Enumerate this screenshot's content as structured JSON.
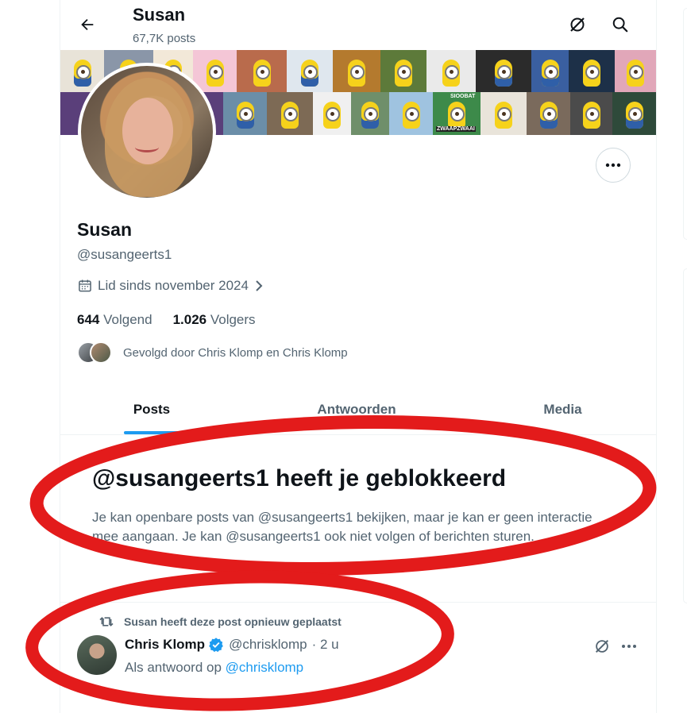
{
  "header": {
    "name": "Susan",
    "post_count": "67,7K posts"
  },
  "profile": {
    "name": "Susan",
    "handle": "@susangeerts1",
    "joined": "Lid sinds november 2024",
    "following_count": "644",
    "following_label": "Volgend",
    "followers_count": "1.026",
    "followers_label": "Volgers",
    "followed_by": "Gevolgd door Chris Klomp en Chris Klomp"
  },
  "banner": {
    "tile_texts": [
      "SIOOBAT",
      "ZWAAPZWAAI"
    ]
  },
  "tabs": [
    {
      "label": "Posts",
      "active": true
    },
    {
      "label": "Antwoorden",
      "active": false
    },
    {
      "label": "Media",
      "active": false
    }
  ],
  "blocked": {
    "title": "@susangeerts1 heeft je geblokkeerd",
    "text": "Je kan openbare posts van @susangeerts1 bekijken, maar je kan er geen interactie mee aangaan. Je kan @susangeerts1 ook niet volgen of berichten sturen."
  },
  "post": {
    "repost_label": "Susan heeft deze post opnieuw geplaatst",
    "author_name": "Chris Klomp",
    "author_handle": "@chrisklomp",
    "time": "· 2 u",
    "reply_prefix": "Als antwoord op",
    "reply_to": "@chrisklomp"
  },
  "colors": {
    "accent": "#1d9bf0",
    "annotation": "#e31b1b",
    "text_primary": "#0f1419",
    "text_secondary": "#536471"
  },
  "icons": {
    "back": "arrow-left-icon",
    "grok": "grok-icon",
    "search": "search-icon",
    "more": "more-icon",
    "calendar": "calendar-icon",
    "chevron": "chevron-right-icon",
    "repost": "repost-icon",
    "verified": "verified-badge-icon"
  }
}
